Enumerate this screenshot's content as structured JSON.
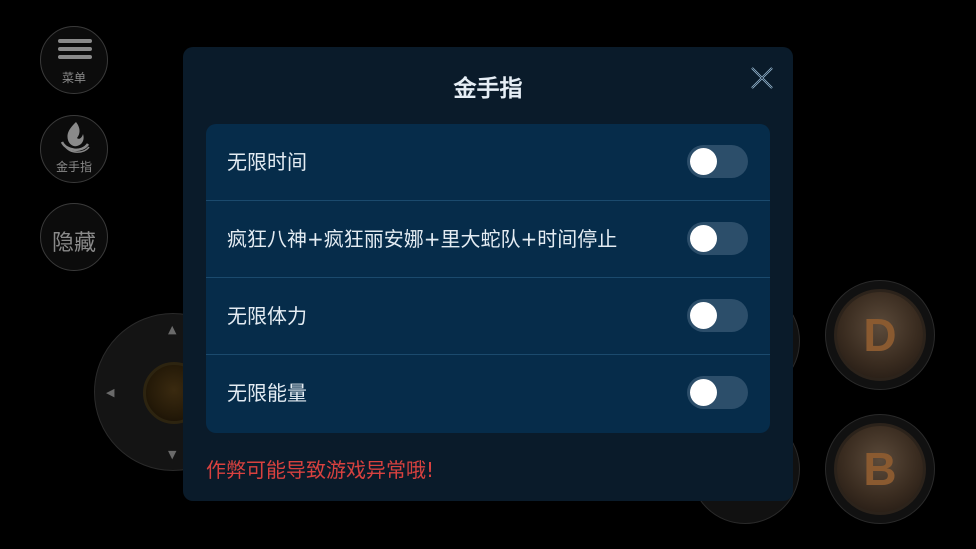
{
  "side_menu": {
    "menu_label": "菜单",
    "cheat_label": "金手指",
    "hide_label": "隐藏"
  },
  "game_buttons": {
    "d_label": "D",
    "b_label": "B"
  },
  "dialog": {
    "title": "金手指",
    "cheats": [
      {
        "label": "无限时间",
        "enabled": false
      },
      {
        "label": "疯狂八神+疯狂丽安娜+里大蛇队+时间停止",
        "enabled": false
      },
      {
        "label": "无限体力",
        "enabled": false
      },
      {
        "label": "无限能量",
        "enabled": false
      }
    ],
    "warning": "作弊可能导致游戏异常哦!"
  },
  "colors": {
    "dialog_bg": "#0a1b2a",
    "panel_bg": "#062c4a",
    "toggle_off": "#2c4e6a",
    "warning_text": "#d8413f"
  },
  "icons": {
    "menu": "hamburger-icon",
    "cheat": "flame-icon",
    "close": "close-icon"
  }
}
